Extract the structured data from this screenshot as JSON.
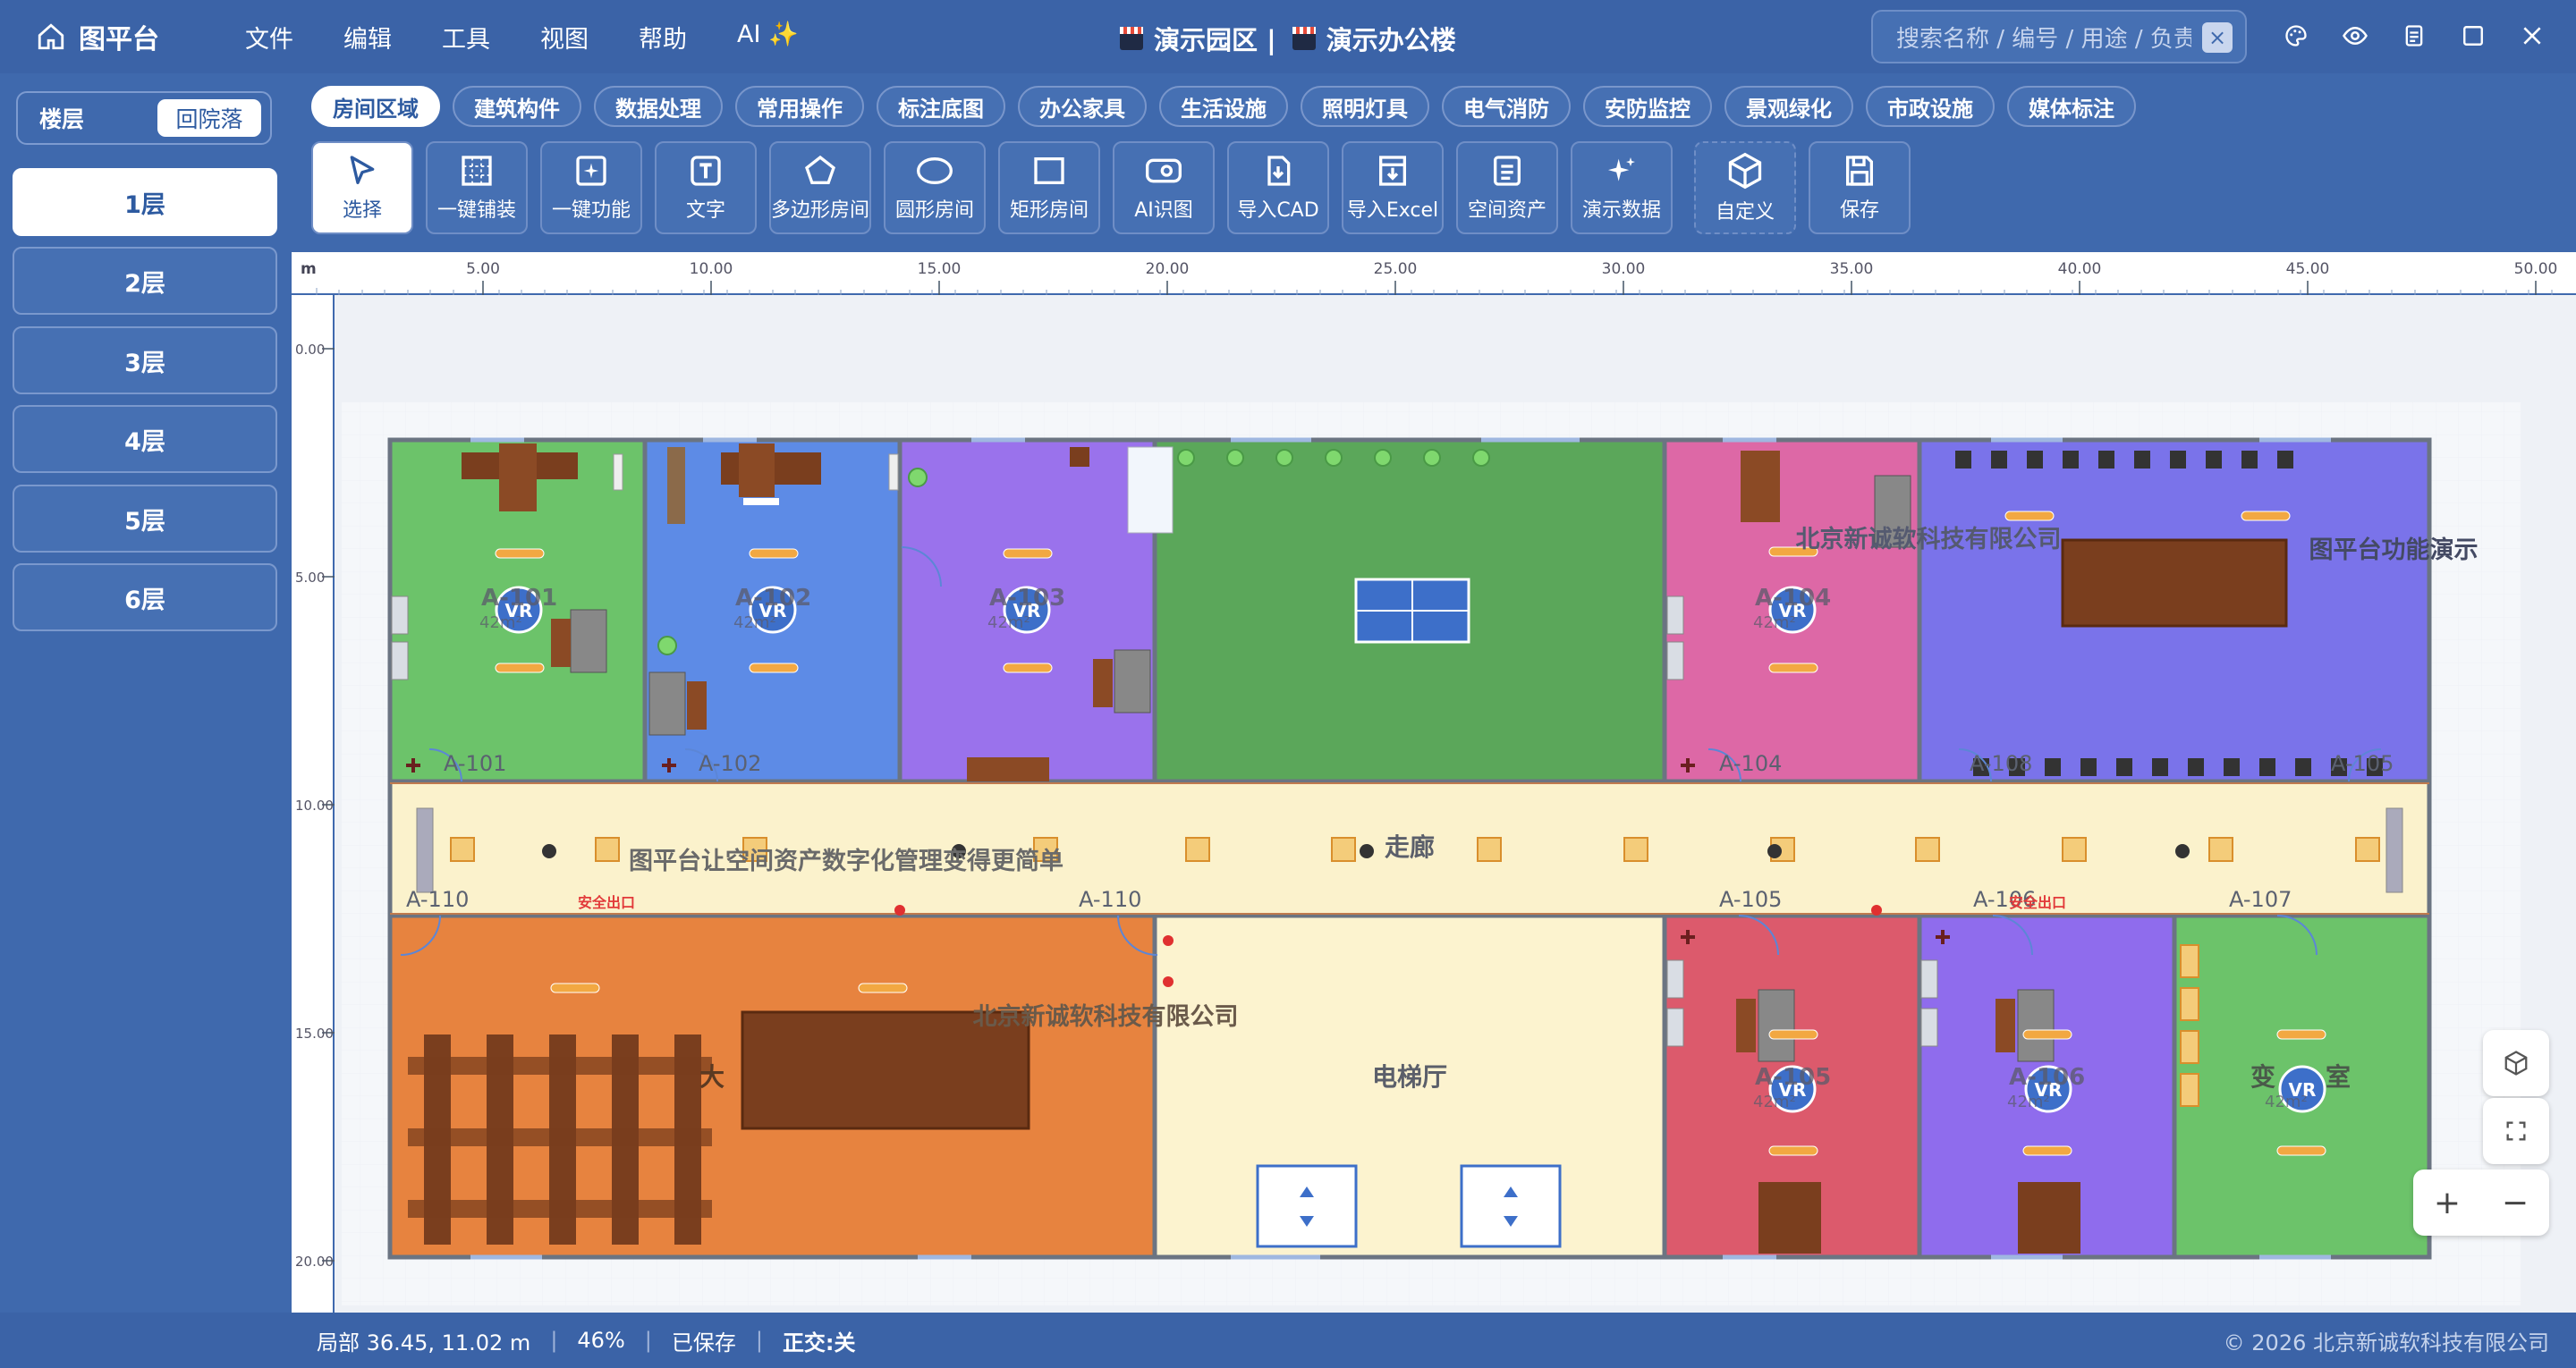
{
  "app": {
    "name": "图平台",
    "title_left": "演示园区 |",
    "title_right": "演示办公楼"
  },
  "menu": [
    "文件",
    "编辑",
    "工具",
    "视图",
    "帮助",
    "AI ✨"
  ],
  "search": {
    "placeholder": "搜索名称 / 编号 / 用途 / 负责人",
    "clear": "×"
  },
  "sidebar": {
    "seg_a": "楼层",
    "seg_b": "回院落",
    "floors": [
      "1层",
      "2层",
      "3层",
      "4层",
      "5层",
      "6层"
    ]
  },
  "cats": [
    "房间区域",
    "建筑构件",
    "数据处理",
    "常用操作",
    "标注底图",
    "办公家具",
    "生活设施",
    "照明灯具",
    "电气消防",
    "安防监控",
    "景观绿化",
    "市政设施",
    "媒体标注"
  ],
  "tools": [
    "选择",
    "一键铺装",
    "一键功能",
    "文字",
    "多边形房间",
    "圆形房间",
    "矩形房间",
    "AI识图",
    "导入CAD",
    "导入Excel",
    "空间资产",
    "演示数据",
    "自定义",
    "保存"
  ],
  "ruler": {
    "unit": "m",
    "x": [
      "5.00",
      "10.00",
      "15.00",
      "20.00",
      "25.00",
      "30.00",
      "35.00",
      "40.00",
      "45.00",
      "50.00"
    ],
    "y": [
      "0.00",
      "5.00",
      "10.00",
      "15.00",
      "20.00"
    ]
  },
  "plan": {
    "rooms": [
      "A-101",
      "A-102",
      "A-103",
      "A-104",
      "A-105",
      "A-106",
      "A-107",
      "A-108",
      "A-110"
    ],
    "room_top": [
      "A-101",
      "A-102",
      "A-104",
      "A-108",
      "A-105"
    ],
    "room_bottom": [
      "A-110",
      "A-110",
      "A-105",
      "A-106",
      "A-107"
    ],
    "area": "42m²",
    "corridor": "走廊",
    "corridor_slogan": "图平台让空间资产数字化管理变得更简单",
    "company": "北京新诚软科技有限公司",
    "company2": "北京新诚软科技有限公司",
    "demo": "图平台功能演示",
    "elevator": "电梯厅",
    "big": "大",
    "bian": "变",
    "shi": "室",
    "exit": "安全出口",
    "vr": "VR"
  },
  "status": {
    "coords": "局部 36.45, 11.02 m",
    "zoom": "46%",
    "saved": "已保存",
    "ortho": "正交:关",
    "copyright": "© 2026 北京新诚软科技有限公司"
  },
  "colors": {
    "accent": "#3f69ad"
  }
}
